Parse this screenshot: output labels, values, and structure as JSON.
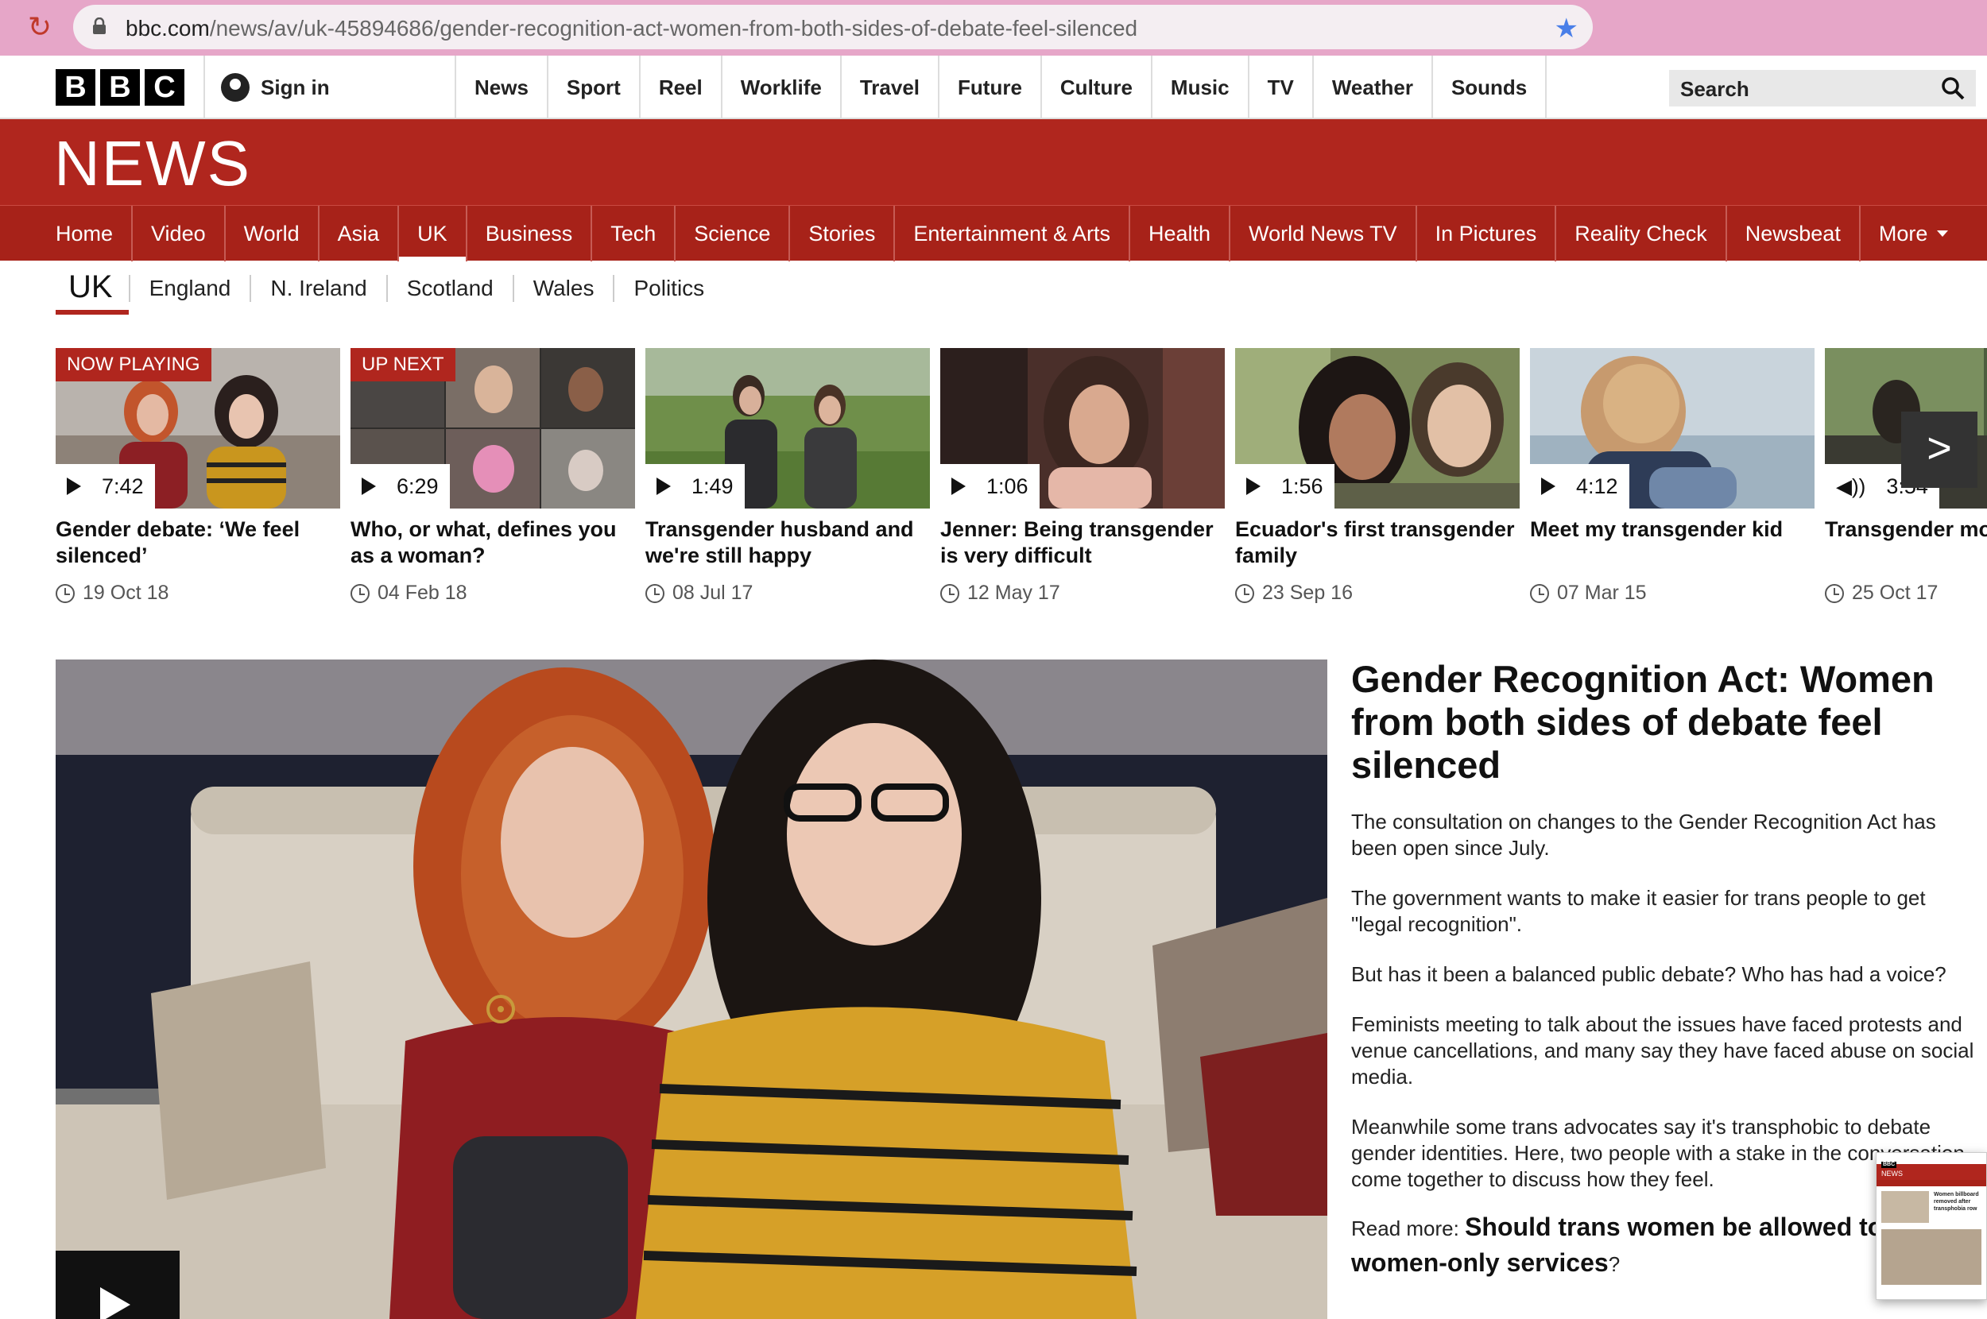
{
  "browser": {
    "url_domain": "bbc.com",
    "url_path": "/news/av/uk-45894686/gender-recognition-act-women-from-both-sides-of-debate-feel-silenced"
  },
  "topbar": {
    "logo_letters": [
      "B",
      "B",
      "C"
    ],
    "sign_in": "Sign in",
    "nav": [
      "News",
      "Sport",
      "Reel",
      "Worklife",
      "Travel",
      "Future",
      "Culture",
      "Music",
      "TV",
      "Weather",
      "Sounds"
    ],
    "search_placeholder": "Search"
  },
  "banner": {
    "title": "NEWS"
  },
  "section_nav": {
    "items": [
      "Home",
      "Video",
      "World",
      "Asia",
      "UK",
      "Business",
      "Tech",
      "Science",
      "Stories",
      "Entertainment & Arts",
      "Health",
      "World News TV",
      "In Pictures",
      "Reality Check",
      "Newsbeat",
      "More"
    ],
    "active": "UK"
  },
  "sub_nav": {
    "current": "UK",
    "items": [
      "England",
      "N. Ireland",
      "Scotland",
      "Wales",
      "Politics"
    ]
  },
  "carousel": [
    {
      "badge": "NOW PLAYING",
      "duration": "7:42",
      "title": "Gender debate: ‘We feel silenced’",
      "date": "19 Oct 18"
    },
    {
      "badge": "UP NEXT",
      "duration": "6:29",
      "title": "Who, or what, defines you as a woman?",
      "date": "04 Feb 18"
    },
    {
      "badge": "",
      "duration": "1:49",
      "title": "Transgender husband and we're still happy",
      "date": "08 Jul 17"
    },
    {
      "badge": "",
      "duration": "1:06",
      "title": "Jenner: Being transgender is very difficult",
      "date": "12 May 17"
    },
    {
      "badge": "",
      "duration": "1:56",
      "title": "Ecuador's first transgender family",
      "date": "23 Sep 16"
    },
    {
      "badge": "",
      "duration": "4:12",
      "title": "Meet my transgender kid",
      "date": "07 Mar 15"
    },
    {
      "badge": "",
      "duration": "3:54",
      "title": "Transgender model Playboy centrefold",
      "date": "25 Oct 17"
    }
  ],
  "article": {
    "headline": "Gender Recognition Act: Women from both sides of debate feel silenced",
    "paragraphs": [
      "The consultation on changes to the Gender Recognition Act has been open since July.",
      "The government wants to make it easier for trans people to get \"legal recognition\".",
      "But has it been a balanced public debate? Who has had a voice?",
      "Feminists meeting to talk about the issues have faced protests and venue cancellations, and many say they have faced abuse on social media.",
      "Meanwhile some trans advocates say it's transphobic to debate gender identities. Here, two people with a stake in the conversation come together to discuss how they feel."
    ],
    "read_more_prefix": "Read more: ",
    "read_more_link": "Should trans women be allowed to use women-only services",
    "read_more_suffix": "?"
  },
  "popup": {
    "logo": "BBC",
    "label": "NEWS",
    "headline": "Women billboard removed after transphobia row"
  },
  "colors": {
    "bbc_red": "#b0261e",
    "browser_bar": "#e6a6c8",
    "link_star": "#4a7fe8"
  }
}
